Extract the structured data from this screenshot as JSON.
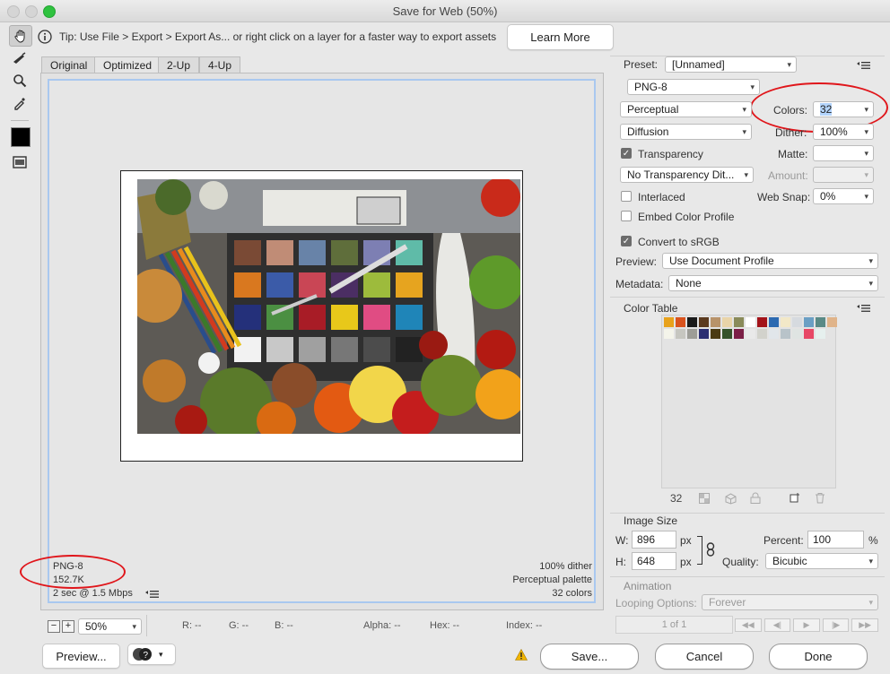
{
  "window": {
    "title": "Save for Web (50%)"
  },
  "tip": {
    "text": "Tip: Use File > Export > Export As... or right click on a layer for a faster way to export assets",
    "button": "Learn More"
  },
  "tabs": [
    "Original",
    "Optimized",
    "2-Up",
    "4-Up"
  ],
  "image_info": {
    "format": "PNG-8",
    "size": "152.7K",
    "speed": "2 sec @ 1.5 Mbps",
    "dither": "100% dither",
    "palette": "Perceptual palette",
    "colors": "32 colors"
  },
  "bottom": {
    "zoom": "50%",
    "r": "R: --",
    "g": "G: --",
    "b": "B: --",
    "alpha": "Alpha: --",
    "hex": "Hex: --",
    "index": "Index: --"
  },
  "footer_buttons": {
    "preview": "Preview...",
    "save": "Save...",
    "cancel": "Cancel",
    "done": "Done"
  },
  "settings": {
    "preset_label": "Preset:",
    "preset": "[Unnamed]",
    "format": "PNG-8",
    "reduction": "Perceptual",
    "colors_label": "Colors:",
    "colors": "32",
    "dither_algo": "Diffusion",
    "dither_label": "Dither:",
    "dither": "100%",
    "transparency": "Transparency",
    "matte_label": "Matte:",
    "transparency_dither": "No Transparency Dit...",
    "amount_label": "Amount:",
    "interlaced": "Interlaced",
    "web_snap_label": "Web Snap:",
    "web_snap": "0%",
    "embed_profile": "Embed Color Profile",
    "convert_srgb": "Convert to sRGB",
    "preview_label": "Preview:",
    "preview": "Use Document Profile",
    "metadata_label": "Metadata:",
    "metadata": "None"
  },
  "color_table": {
    "title": "Color Table",
    "count": "32",
    "swatches": [
      "#e8a21c",
      "#d9531e",
      "#1a1a1a",
      "#5b3a1f",
      "#b8936a",
      "#e9d4a9",
      "#8a8b5a",
      "#ffffff",
      "#a3131a",
      "#2c6ab1",
      "#f2e8c8",
      "#d6dadf",
      "#6b9fc4",
      "#5a8a86",
      "#e0b48a",
      "#f4f4ea",
      "#c6c6c0",
      "#9d9d97",
      "#2b2f72",
      "#4a3a13",
      "#35532a",
      "#7b1f46",
      "#e9e9e9",
      "#d2d2cc",
      "#e1e6ea",
      "#b8c3c9",
      "#dfe4e2",
      "#e74866",
      "#e6f0ee"
    ]
  },
  "image_size": {
    "title": "Image Size",
    "w_label": "W:",
    "w": "896",
    "h_label": "H:",
    "h": "648",
    "unit": "px",
    "percent_label": "Percent:",
    "percent": "100",
    "percent_unit": "%",
    "quality_label": "Quality:",
    "quality": "Bicubic"
  },
  "animation": {
    "title": "Animation",
    "looping_label": "Looping Options:",
    "looping": "Forever",
    "frame": "1 of 1"
  }
}
